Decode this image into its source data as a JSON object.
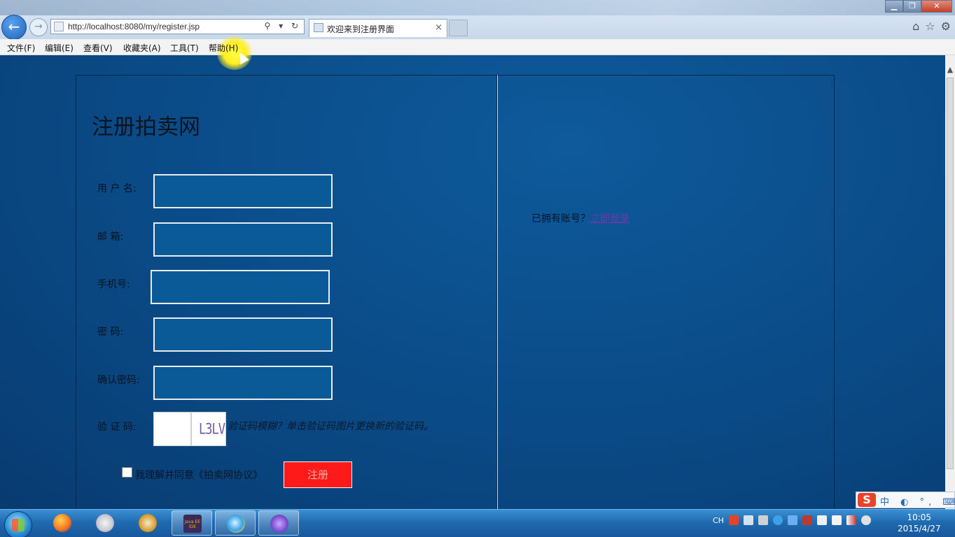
{
  "browser": {
    "url": "http://localhost:8080/my/register.jsp",
    "tab_title": "欢迎来到注册界面",
    "tab_close": "×",
    "back_icon": "←",
    "forward_icon": "→",
    "address_controls": "⚲ ▾ ↻",
    "window_controls": {
      "min": "▁",
      "max": "❐",
      "close": "✕"
    },
    "right_tools": [
      "⌂",
      "☆",
      "⚙"
    ]
  },
  "menu": {
    "items": [
      "文件(F)",
      "编辑(E)",
      "查看(V)",
      "收藏夹(A)",
      "工具(T)",
      "帮助(H)"
    ]
  },
  "form": {
    "title": "注册拍卖网",
    "fields": [
      {
        "label": "用 户 名:",
        "value": ""
      },
      {
        "label": "邮    箱:",
        "value": ""
      },
      {
        "label": "手机号:",
        "value": ""
      },
      {
        "label": "密      码:",
        "value": ""
      },
      {
        "label": "确认密码:",
        "value": ""
      }
    ],
    "captcha_label": "验 证 码:",
    "captcha_value": "",
    "captcha_image_text": "L3LV",
    "captcha_hint": "验证码模糊？单击验证码图片更换新的验证码。",
    "agree_text": "我理解并同意《拍卖网协议》",
    "agree_checked": false,
    "submit_label": "注册"
  },
  "side": {
    "have_account_text": "已拥有账号？",
    "login_link_text": "立即登录"
  },
  "taskbar": {
    "apps": [
      "firefox",
      "app-2",
      "search-app",
      "java-ee-ide",
      "internet-explorer",
      "app-6"
    ],
    "java_ee_label": "Java EE IDE",
    "tray_lang": "CH",
    "clock_time": "10:05",
    "clock_date": "2015/4/27"
  },
  "ime": {
    "logo": "S",
    "items": "中 ◐ °, ⌨ ✎"
  },
  "colors": {
    "page_bg": "#0c4a86",
    "input_bg": "#0a5a98",
    "submit_bg": "#ff1a1a",
    "link": "#6a3aa8"
  }
}
